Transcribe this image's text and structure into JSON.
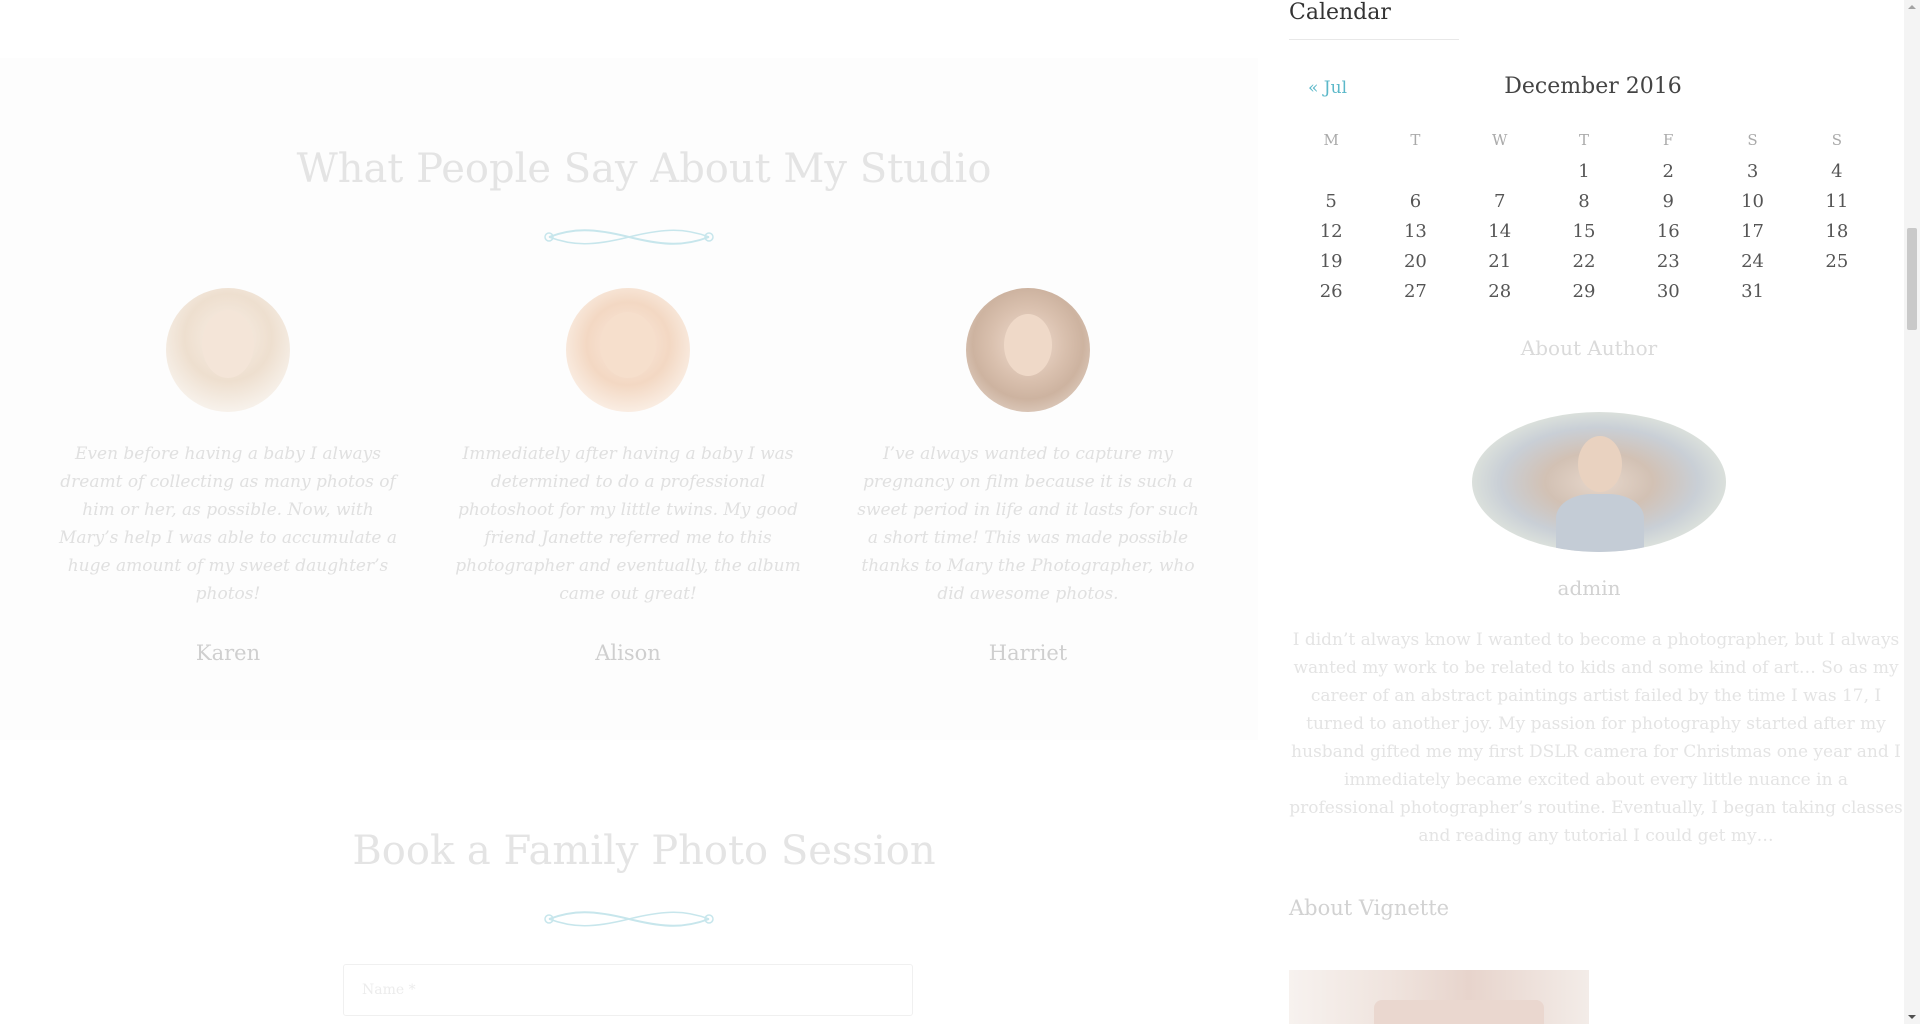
{
  "testimonials": {
    "title": "What People Say About My Studio",
    "items": [
      {
        "name": "Karen",
        "text": "Even before having a baby I always dreamt of collecting as many photos of him or her, as possible. Now, with Mary’s help I was able to accumulate a huge amount of my sweet daughter’s photos!"
      },
      {
        "name": "Alison",
        "text": "Immediately after having a baby I was determined to do a professional photoshoot for my little twins. My good friend Janette referred me to this photographer and eventually, the album came out great!"
      },
      {
        "name": "Harriet",
        "text": "I’ve always wanted to capture my pregnancy on film because it is such a sweet period in life and it lasts for such a short time! This was made possible thanks to Mary the Photographer, who did awesome photos."
      }
    ]
  },
  "booking": {
    "title": "Book a Family Photo Session",
    "name_placeholder": "Name *"
  },
  "sidebar": {
    "calendar": {
      "widget_title": "Calendar",
      "prev_link": "« Jul",
      "caption": "December 2016",
      "weekdays": [
        "M",
        "T",
        "W",
        "T",
        "F",
        "S",
        "S"
      ],
      "weeks": [
        [
          "",
          "",
          "",
          "1",
          "2",
          "3",
          "4"
        ],
        [
          "5",
          "6",
          "7",
          "8",
          "9",
          "10",
          "11"
        ],
        [
          "12",
          "13",
          "14",
          "15",
          "16",
          "17",
          "18"
        ],
        [
          "19",
          "20",
          "21",
          "22",
          "23",
          "24",
          "25"
        ],
        [
          "26",
          "27",
          "28",
          "29",
          "30",
          "31",
          ""
        ]
      ]
    },
    "about_author": {
      "title": "About Author",
      "name": "admin",
      "bio": "I didn’t always know I wanted to become a photographer, but I always wanted my work to be related to kids and some kind of art… So as my career of an abstract paintings artist failed by the time I was 17, I turned to another joy. My passion for photography started after my husband gifted me my first DSLR camera for Christmas one year and I immediately became excited about every little nuance in a professional photographer’s routine. Eventually, I began taking classes and reading any tutorial I could get my…"
    },
    "vignette": {
      "title": "About Vignette"
    }
  },
  "colors": {
    "accent": "#5bb8c9"
  }
}
